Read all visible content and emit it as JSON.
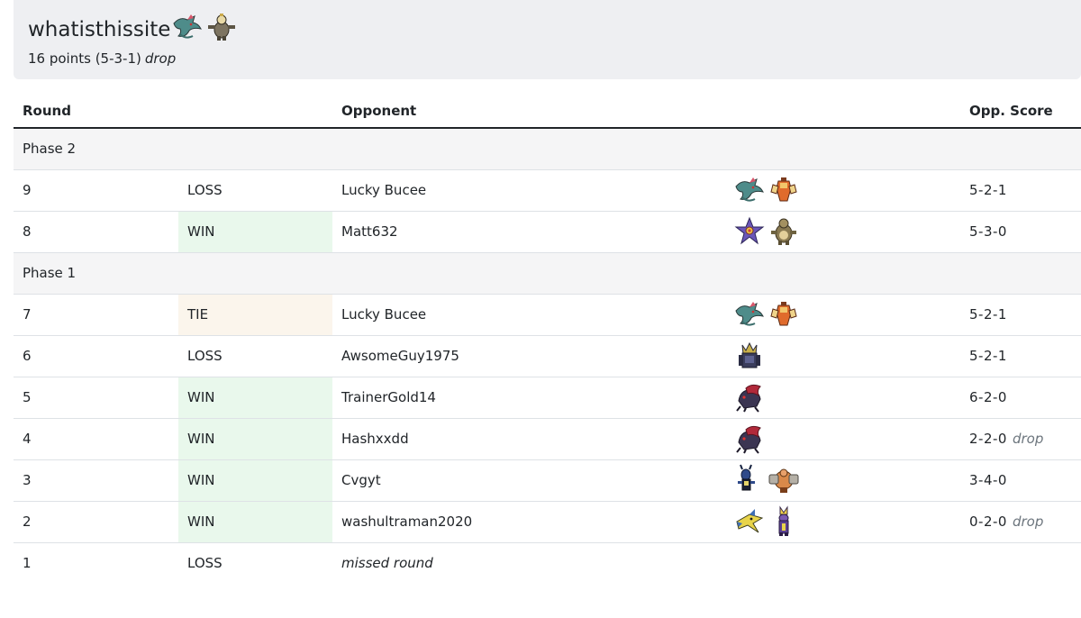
{
  "player": {
    "name": "whatisthissite",
    "record": "16 points (5-3-1)",
    "drop": "drop",
    "team_icons": [
      "dragapult-icon",
      "tinkaton-like-icon"
    ]
  },
  "table": {
    "headers": {
      "round": "Round",
      "result": "",
      "opponent": "Opponent",
      "team": "",
      "opp_score": "Opp. Score"
    },
    "phases": [
      {
        "label": "Phase 2",
        "rows": [
          {
            "round": "9",
            "result": "LOSS",
            "result_type": "loss",
            "opponent": "Lucky Bucee",
            "team": [
              "dragapult-icon",
              "armarouge-icon"
            ],
            "score": "5-2-1",
            "drop": ""
          },
          {
            "round": "8",
            "result": "WIN",
            "result_type": "win",
            "opponent": "Matt632",
            "team": [
              "starmie-icon",
              "kangaskhan-icon"
            ],
            "score": "5-3-0",
            "drop": ""
          }
        ]
      },
      {
        "label": "Phase 1",
        "rows": [
          {
            "round": "7",
            "result": "TIE",
            "result_type": "tie",
            "opponent": "Lucky Bucee",
            "team": [
              "dragapult-icon",
              "armarouge-icon"
            ],
            "score": "5-2-1",
            "drop": ""
          },
          {
            "round": "6",
            "result": "LOSS",
            "result_type": "loss",
            "opponent": "AwsomeGuy1975",
            "team": [
              "kingambit-icon"
            ],
            "score": "5-2-1",
            "drop": ""
          },
          {
            "round": "5",
            "result": "WIN",
            "result_type": "win",
            "opponent": "TrainerGold14",
            "team": [
              "zoroark-icon"
            ],
            "score": "6-2-0",
            "drop": ""
          },
          {
            "round": "4",
            "result": "WIN",
            "result_type": "win",
            "opponent": "Hashxxdd",
            "team": [
              "zoroark-icon"
            ],
            "score": "2-2-0",
            "drop": "drop"
          },
          {
            "round": "3",
            "result": "WIN",
            "result_type": "win",
            "opponent": "Cvgyt",
            "team": [
              "lucario-icon",
              "conkeldurr-icon"
            ],
            "score": "3-4-0",
            "drop": ""
          },
          {
            "round": "2",
            "result": "WIN",
            "result_type": "win",
            "opponent": "washultraman2020",
            "team": [
              "kilowattrel-icon",
              "toxtricity-icon"
            ],
            "score": "0-2-0",
            "drop": "drop"
          },
          {
            "round": "1",
            "result": "LOSS",
            "result_type": "loss",
            "opponent": "missed round",
            "opponent_missed": true,
            "team": [],
            "score": "",
            "drop": ""
          }
        ]
      }
    ]
  },
  "colors": {
    "win_bg": "#e9f8ec",
    "tie_bg": "#fbf5ec",
    "phase_bg": "#f5f5f6",
    "header_card_bg": "#eeeff2"
  }
}
